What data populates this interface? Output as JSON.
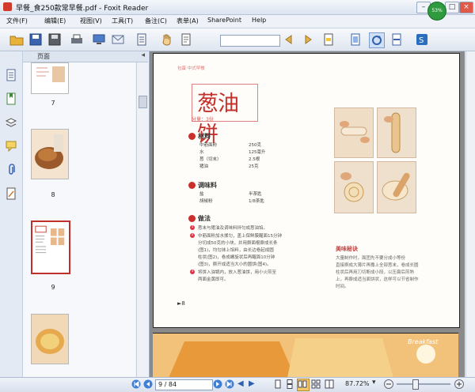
{
  "window": {
    "title": "早餐_食250款常早餐.pdf - Foxit Reader",
    "progress_badge": "53%"
  },
  "menu": [
    "文件(F)",
    "编辑(E)",
    "视图(V)",
    "工具(T)",
    "备注(C)",
    "表单(A)",
    "SharePoint",
    "Help"
  ],
  "sidebar": {
    "panel_title": "页面",
    "thumbnails": [
      {
        "page": "7"
      },
      {
        "page": "8"
      },
      {
        "page": "9"
      },
      {
        "page": ""
      }
    ]
  },
  "document": {
    "header_note": "包蛋 中式早餐",
    "recipe_title": "葱油饼",
    "serving": "分量：3份",
    "sections": {
      "materials": "材料",
      "seasoning": "调味料",
      "method": "做法"
    },
    "materials_items": [
      {
        "name": "中筋面粉",
        "qty": "250克"
      },
      {
        "name": "水",
        "qty": "125毫升"
      },
      {
        "name": "葱（切末）",
        "qty": "2.5根"
      },
      {
        "name": "猪油",
        "qty": "25克"
      }
    ],
    "seasoning_items": [
      {
        "name": "盐",
        "qty": "半茶匙"
      },
      {
        "name": "胡椒粉",
        "qty": "1/8茶匙"
      }
    ],
    "steps": [
      {
        "num": "1",
        "lines": [
          "葱末与猪油及调味料拌匀成葱油馅。"
        ]
      },
      {
        "num": "2",
        "lines": [
          "中筋面粉加水揉匀，盖上保鲜膜醒面15分钟",
          "分切成50克的小块，并用擀面棍擀成长条",
          "(图1)，均匀抹上馅料，由长边卷起成圆",
          "柱状(图2)，卷成螺旋状后再醒面10分钟",
          "(图3)，擀开成适当大小的圆饼(图4)。"
        ]
      },
      {
        "num": "3",
        "lines": [
          "将饼入油锅内，放入葱油饼，用小火煎至",
          "两面金黄即可。"
        ]
      }
    ],
    "tip_title": "美味秘诀",
    "tip_lines": [
      "大量制作时，面团先不要分成小等份",
      "直接擀成大薄片再撒上全部葱末，卷成长圆",
      "柱状后再用刀切断成小段，以压扁后煎熟",
      "上，再擀成适当面饼状，这样可以节省制作",
      "时间。"
    ],
    "page_marker": "►8",
    "next_page_label": "Breakfast"
  },
  "status": {
    "page_field": "9 / 84",
    "zoom": "87.72%"
  },
  "colors": {
    "accent": "#c4302b",
    "frame": "#dfe7f3"
  }
}
